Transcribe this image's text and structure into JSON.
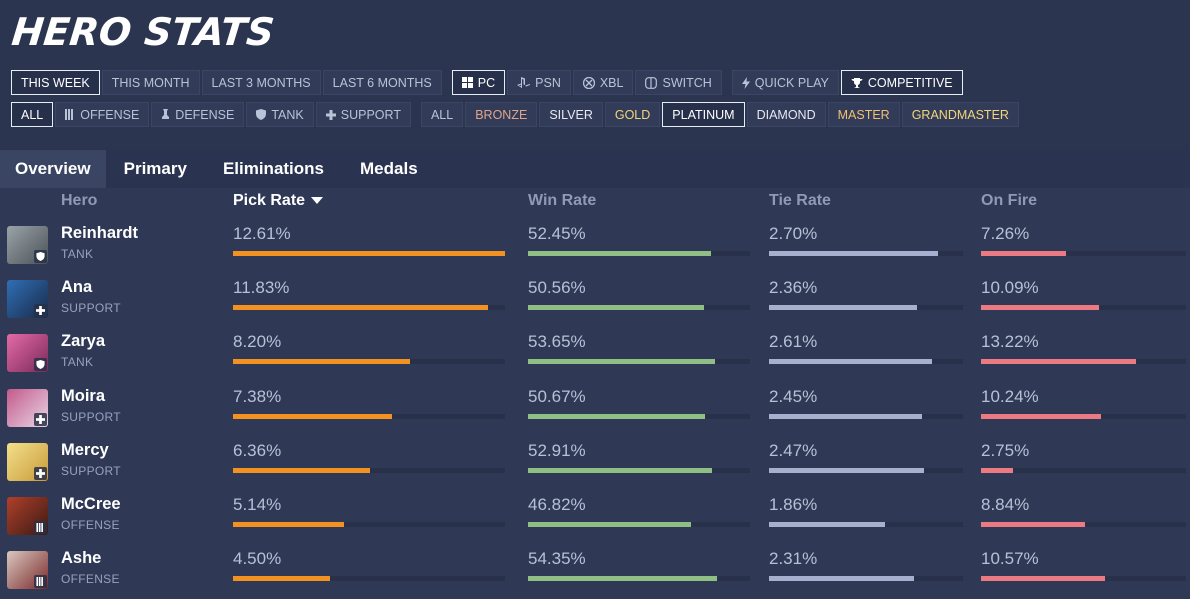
{
  "title": "HERO STATS",
  "filters": {
    "time": [
      "THIS WEEK",
      "THIS MONTH",
      "LAST 3 MONTHS",
      "LAST 6 MONTHS"
    ],
    "time_active": 0,
    "platform": [
      {
        "label": "PC",
        "icon": "windows-icon"
      },
      {
        "label": "PSN",
        "icon": "playstation-icon"
      },
      {
        "label": "XBL",
        "icon": "xbox-icon"
      },
      {
        "label": "SWITCH",
        "icon": "switch-icon"
      }
    ],
    "platform_active": 0,
    "mode": [
      {
        "label": "QUICK PLAY",
        "icon": "lightning-icon"
      },
      {
        "label": "COMPETITIVE",
        "icon": "trophy-icon"
      }
    ],
    "mode_active": 1,
    "roles": [
      {
        "label": "ALL",
        "icon": ""
      },
      {
        "label": "OFFENSE",
        "icon": "offense-icon"
      },
      {
        "label": "DEFENSE",
        "icon": "defense-icon"
      },
      {
        "label": "TANK",
        "icon": "shield-icon"
      },
      {
        "label": "SUPPORT",
        "icon": "plus-icon"
      }
    ],
    "roles_active": 0,
    "ranks": [
      {
        "label": "ALL",
        "color": "#b9c2d6"
      },
      {
        "label": "BRONZE",
        "color": "#e0a48a"
      },
      {
        "label": "SILVER",
        "color": "#e6e9f0"
      },
      {
        "label": "GOLD",
        "color": "#f3d57a"
      },
      {
        "label": "PLATINUM",
        "color": "#e6e9f0"
      },
      {
        "label": "DIAMOND",
        "color": "#e6e9f0"
      },
      {
        "label": "MASTER",
        "color": "#f0c070"
      },
      {
        "label": "GRANDMASTER",
        "color": "#f3d57a"
      }
    ],
    "ranks_active": 4
  },
  "tabs": [
    "Overview",
    "Primary",
    "Eliminations",
    "Medals"
  ],
  "tab_active": 0,
  "columns": {
    "hero": "Hero",
    "pick": "Pick Rate",
    "win": "Win Rate",
    "tie": "Tie Rate",
    "fire": "On Fire"
  },
  "colors": {
    "pick": "#f39220",
    "win": "#8fbf84",
    "tie": "#a7b0cf",
    "fire": "#ec7a82"
  },
  "heroes": [
    {
      "name": "Reinhardt",
      "role": "TANK",
      "role_icon": "shield-icon",
      "avatar": [
        "#9aa3a8",
        "#4a5258"
      ],
      "pick": "12.61%",
      "pick_v": 12.61,
      "win": "52.45%",
      "win_v": 52.45,
      "tie": "2.70%",
      "tie_v": 2.7,
      "fire": "7.26%",
      "fire_v": 7.26
    },
    {
      "name": "Ana",
      "role": "SUPPORT",
      "role_icon": "plus-icon",
      "avatar": [
        "#2f6fb5",
        "#1a2a4a"
      ],
      "pick": "11.83%",
      "pick_v": 11.83,
      "win": "50.56%",
      "win_v": 50.56,
      "tie": "2.36%",
      "tie_v": 2.36,
      "fire": "10.09%",
      "fire_v": 10.09
    },
    {
      "name": "Zarya",
      "role": "TANK",
      "role_icon": "shield-icon",
      "avatar": [
        "#e46aa6",
        "#7a2a5a"
      ],
      "pick": "8.20%",
      "pick_v": 8.2,
      "win": "53.65%",
      "win_v": 53.65,
      "tie": "2.61%",
      "tie_v": 2.61,
      "fire": "13.22%",
      "fire_v": 13.22
    },
    {
      "name": "Moira",
      "role": "SUPPORT",
      "role_icon": "plus-icon",
      "avatar": [
        "#c25a8a",
        "#e8d6e6"
      ],
      "pick": "7.38%",
      "pick_v": 7.38,
      "win": "50.67%",
      "win_v": 50.67,
      "tie": "2.45%",
      "tie_v": 2.45,
      "fire": "10.24%",
      "fire_v": 10.24
    },
    {
      "name": "Mercy",
      "role": "SUPPORT",
      "role_icon": "plus-icon",
      "avatar": [
        "#f3e08a",
        "#c99a3a"
      ],
      "pick": "6.36%",
      "pick_v": 6.36,
      "win": "52.91%",
      "win_v": 52.91,
      "tie": "2.47%",
      "tie_v": 2.47,
      "fire": "2.75%",
      "fire_v": 2.75
    },
    {
      "name": "McCree",
      "role": "OFFENSE",
      "role_icon": "offense-icon",
      "avatar": [
        "#b0402a",
        "#3a1a14"
      ],
      "pick": "5.14%",
      "pick_v": 5.14,
      "win": "46.82%",
      "win_v": 46.82,
      "tie": "1.86%",
      "tie_v": 1.86,
      "fire": "8.84%",
      "fire_v": 8.84
    },
    {
      "name": "Ashe",
      "role": "OFFENSE",
      "role_icon": "offense-icon",
      "avatar": [
        "#d9c8c0",
        "#7a2a2a"
      ],
      "pick": "4.50%",
      "pick_v": 4.5,
      "win": "54.35%",
      "win_v": 54.35,
      "tie": "2.31%",
      "tie_v": 2.31,
      "fire": "10.57%",
      "fire_v": 10.57
    }
  ]
}
